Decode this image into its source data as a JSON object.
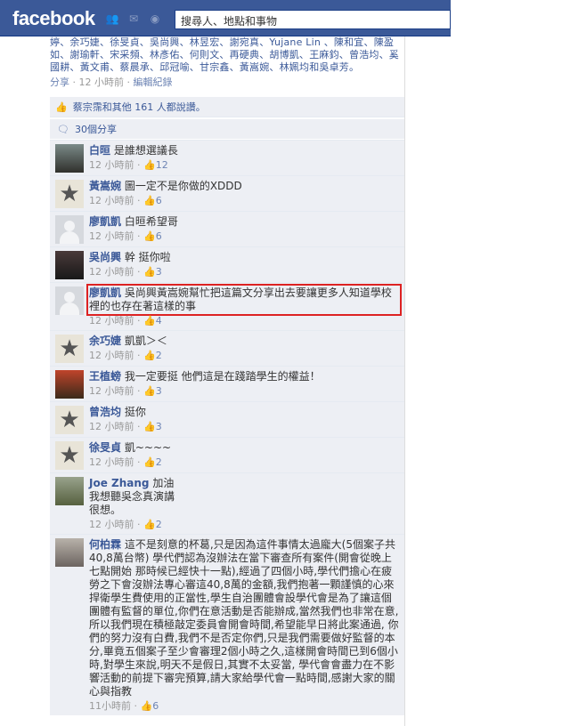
{
  "topbar": {
    "logo": "facebook",
    "search_placeholder": "搜尋人、地點和事物",
    "icons": [
      "friends-icon",
      "messages-icon",
      "globe-icon"
    ]
  },
  "post": {
    "names_text": "婷、余巧婕、徐旻貞、吳尚興、林昱宏、謝宛真、Yujane Lin 、陳和宜、陳盈如、謝瑜軒、宋采頻、林彥佑、何則文、再硬典、胡博凱、王麻鈞、曾浩均、奚國耕、黃文甫、蔡晨承、邱冠喻、甘宗鑫、黃嵩婉、林姵均和吳卓芳。",
    "share": "分享",
    "time": "12 小時前",
    "edit": "編輯紀錄",
    "likes": "蔡宗霈和其他 161 人都說讚。",
    "shares": "30個分享"
  },
  "comments": [
    {
      "name": "白晅",
      "text": "是誰想選議長",
      "time": "12 小時前",
      "likes": "12",
      "avatar": "photo1"
    },
    {
      "name": "黃嵩婉",
      "text": "圖一定不是你做的XDDD",
      "time": "12 小時前",
      "likes": "6",
      "avatar": "star"
    },
    {
      "name": "廖凱凱",
      "text": "白晅希望哥",
      "time": "12 小時前",
      "likes": "6",
      "avatar": "grey"
    },
    {
      "name": "吳尚興",
      "text": "幹 挺你啦",
      "time": "12 小時前",
      "likes": "3",
      "avatar": "photo2"
    },
    {
      "name": "廖凱凱",
      "text": "吳尚興黃嵩婉幫忙把這篇文分享出去要讓更多人知道學校裡的也存在著這樣的事",
      "time": "12 小時前",
      "likes": "4",
      "avatar": "grey",
      "highlight": true
    },
    {
      "name": "余巧婕",
      "text": "凱凱＞＜",
      "time": "12 小時前",
      "likes": "2",
      "avatar": "star"
    },
    {
      "name": "王植螃",
      "text": "我一定要挺 他們這是在踐踏學生的權益！",
      "time": "12 小時前",
      "likes": "3",
      "avatar": "dark"
    },
    {
      "name": "曾浩均",
      "text": "挺你",
      "time": "12 小時前",
      "likes": "3",
      "avatar": "star"
    },
    {
      "name": "徐旻貞",
      "text": "凱~~~~",
      "time": "12 小時前",
      "likes": "2",
      "avatar": "star"
    },
    {
      "name": "Joe Zhang",
      "text": "加油\n我想聽吳念真演講\n很想。",
      "time": "12 小時前",
      "likes": "2",
      "avatar": "photo3"
    },
    {
      "name": "何柏霖",
      "text": "這不是刻意的杯葛,只是因為這件事情太過龐大(5個案子共40,8萬台幣) 學代們認為沒辦法在當下審查所有案件(開會從晚上七點開始 那時候已經快十一點),經過了四個小時,學代們擔心在疲勞之下會沒辦法專心審這40,8萬的金額,我們抱著一顆謹慎的心來捍衛學生費使用的正當性,學生自治團體會設學代會是為了讓這個團體有監督的單位,你們在意活動是否能辦成,當然我們也非常在意,所以我們現在積極敲定委員會開會時間,希望能早日將此案通過, 你們的努力沒有白費,我們不是否定你們,只是我們需要做好監督的本分,畢竟五個案子至少會審理2個小時之久,這樣開會時間已到6個小時,對學生來說,明天不是假日,其實不太妥當, 學代會會盡力在不影響活動的前提下審完預算,請大家給學代會一點時間,感謝大家的關心與指教",
      "time": "11小時前",
      "likes": "6",
      "avatar": "photo4"
    }
  ]
}
